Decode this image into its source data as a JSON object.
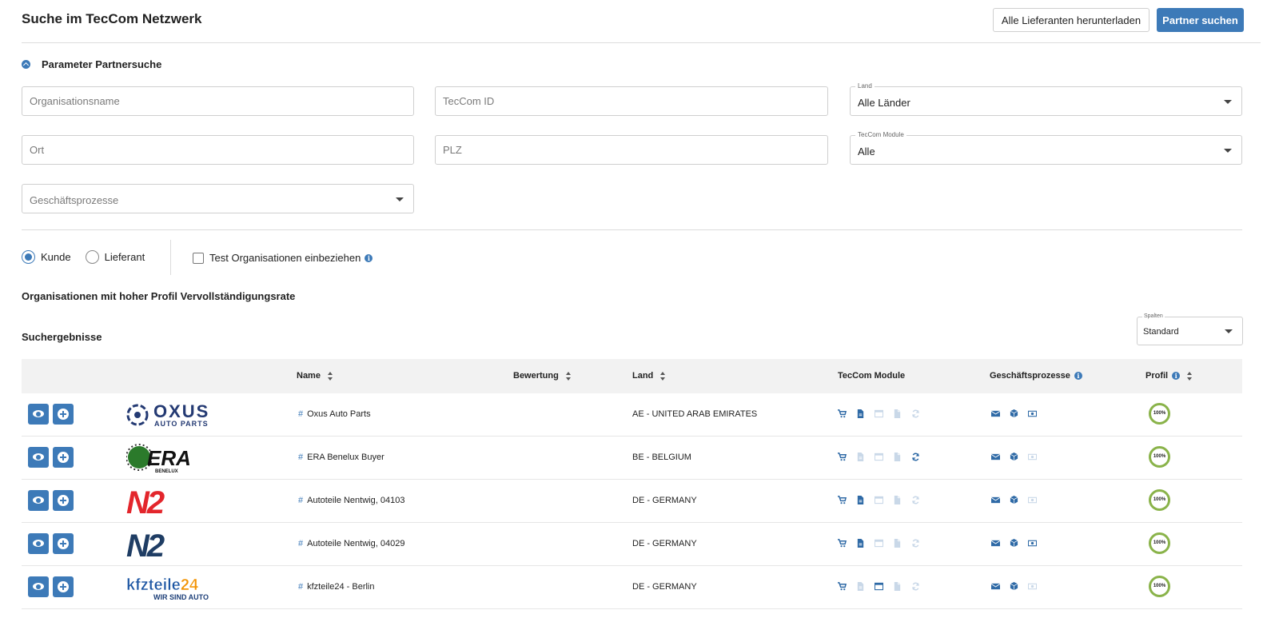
{
  "header": {
    "title": "Suche im TecCom Netzwerk",
    "download_label": "Alle Lieferanten herunterladen",
    "search_label": "Partner suchen"
  },
  "params": {
    "section_label": "Parameter Partnersuche",
    "org_name_placeholder": "Organisationsname",
    "teccom_id_placeholder": "TecCom ID",
    "country_label": "Land",
    "country_value": "Alle Länder",
    "city_placeholder": "Ort",
    "zip_placeholder": "PLZ",
    "modules_label": "TecCom Module",
    "modules_value": "Alle",
    "processes_placeholder": "Geschäftsprozesse"
  },
  "filters": {
    "customer_label": "Kunde",
    "supplier_label": "Lieferant",
    "selected_role": "Kunde",
    "test_orgs_label": "Test Organisationen einbeziehen",
    "test_orgs_checked": false
  },
  "high_profile_heading": "Organisationen mit hoher Profil Vervollständigungsrate",
  "results_heading": "Suchergebnisse",
  "columns_select": {
    "label": "Spalten",
    "value": "Standard"
  },
  "table": {
    "headers": {
      "name": "Name",
      "rating": "Bewertung",
      "country": "Land",
      "modules": "TecCom Module",
      "processes": "Geschäftsprozesse",
      "profile": "Profil"
    },
    "rows": [
      {
        "logo": "OXUS",
        "logo_sub": "AUTO PARTS",
        "name": "Oxus Auto Parts",
        "country": "AE - UNITED ARAB EMIRATES",
        "modules": [
          true,
          true,
          false,
          false,
          false
        ],
        "processes": [
          true,
          true,
          true
        ],
        "profile": "100%"
      },
      {
        "logo": "ERA",
        "logo_sub": "BENELUX",
        "name": "ERA Benelux Buyer",
        "country": "BE - BELGIUM",
        "modules": [
          true,
          false,
          false,
          false,
          true
        ],
        "processes": [
          true,
          true,
          false
        ],
        "profile": "100%"
      },
      {
        "logo": "N2",
        "logo_sub": "",
        "name": "Autoteile Nentwig, 04103",
        "country": "DE - GERMANY",
        "modules": [
          true,
          true,
          false,
          false,
          false
        ],
        "processes": [
          true,
          true,
          false
        ],
        "profile": "100%"
      },
      {
        "logo": "N2",
        "logo_sub": "",
        "name": "Autoteile Nentwig, 04029",
        "country": "DE - GERMANY",
        "modules": [
          true,
          true,
          false,
          false,
          false
        ],
        "processes": [
          true,
          true,
          true
        ],
        "profile": "100%"
      },
      {
        "logo": "kfzteile24",
        "logo_sub": "WIR SIND AUTO",
        "name": "kfzteile24 - Berlin",
        "country": "DE - GERMANY",
        "modules": [
          true,
          false,
          true,
          false,
          false
        ],
        "processes": [
          true,
          true,
          false
        ],
        "profile": "100%"
      }
    ]
  },
  "icons": {
    "module_icons": [
      "cart-icon",
      "document-icon",
      "window-icon",
      "file-icon",
      "sync-icon"
    ],
    "process_icons": [
      "envelope-icon",
      "box-icon",
      "money-icon"
    ]
  },
  "colors": {
    "primary": "#3d7ab8",
    "icon_on": "#2f6aa6",
    "icon_off": "#c9d8e8",
    "profile_ring": "#8ab34a"
  }
}
